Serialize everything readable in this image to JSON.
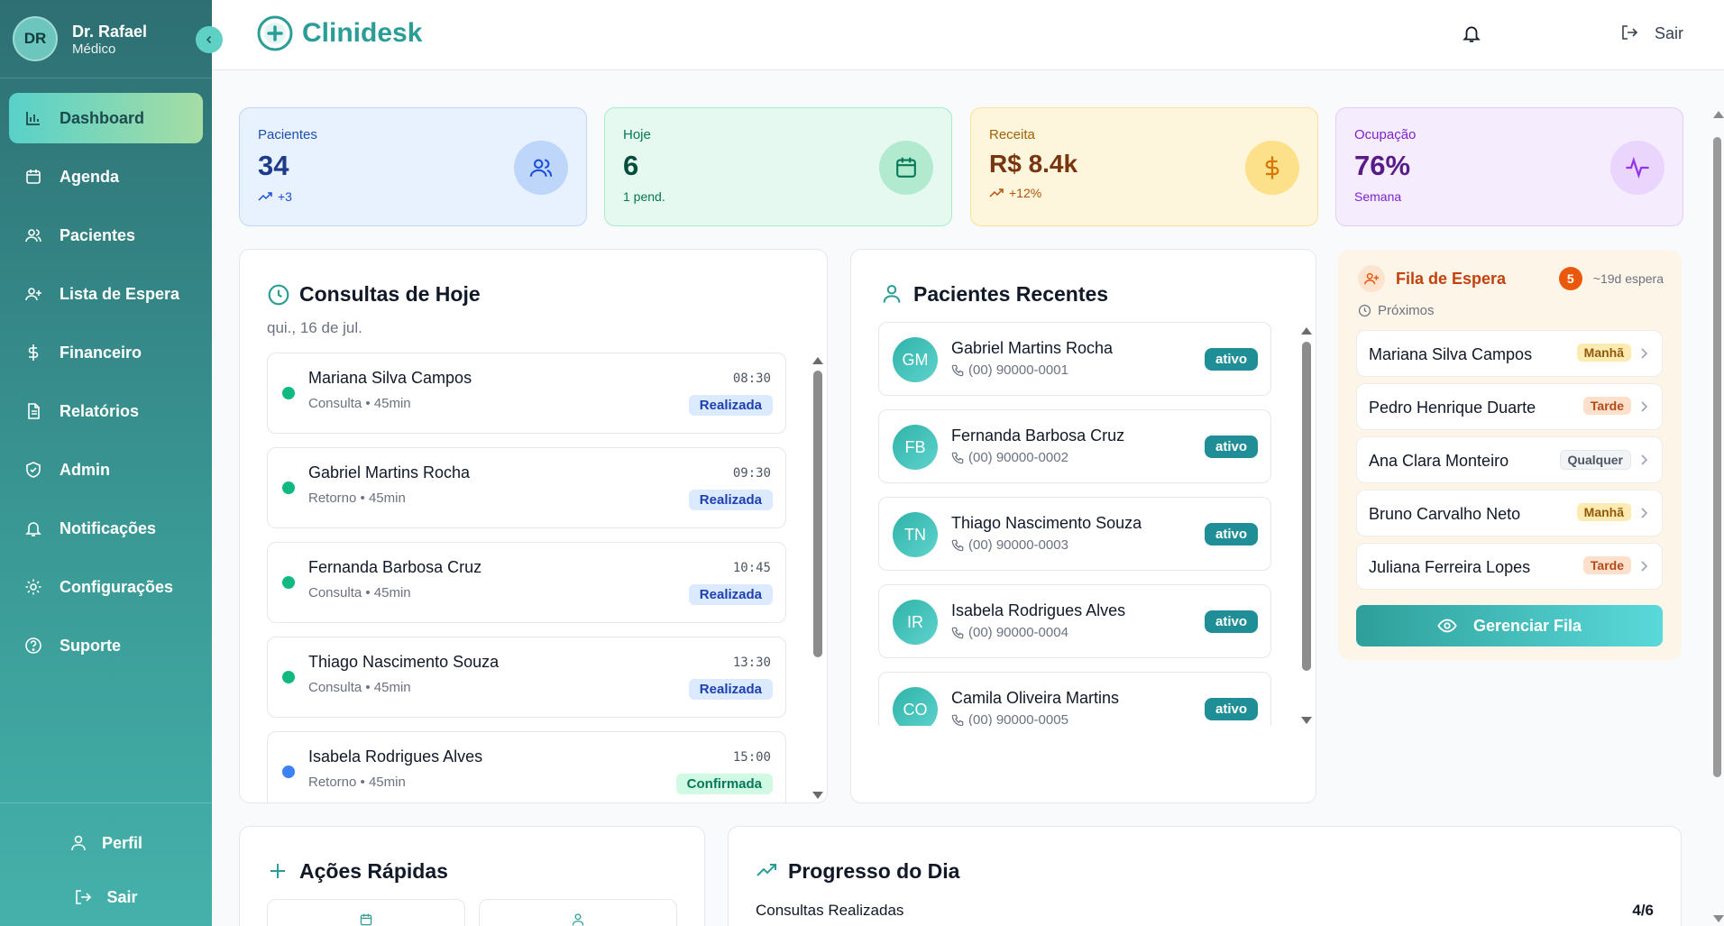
{
  "colors": {
    "accent": "#2a9d96",
    "sidebar": "#2e6f73",
    "queue_accent": "#ea580c"
  },
  "user": {
    "initials": "DR",
    "name": "Dr. Rafael",
    "role": "Médico"
  },
  "nav": [
    {
      "label": "Dashboard",
      "icon": "bar-chart-icon"
    },
    {
      "label": "Agenda",
      "icon": "calendar-icon"
    },
    {
      "label": "Pacientes",
      "icon": "users-icon"
    },
    {
      "label": "Lista de Espera",
      "icon": "user-plus-icon"
    },
    {
      "label": "Financeiro",
      "icon": "dollar-icon"
    },
    {
      "label": "Relatórios",
      "icon": "file-icon"
    },
    {
      "label": "Admin",
      "icon": "shield-icon"
    },
    {
      "label": "Notificações",
      "icon": "bell-icon"
    },
    {
      "label": "Configurações",
      "icon": "gear-icon"
    },
    {
      "label": "Suporte",
      "icon": "help-icon"
    }
  ],
  "footer": {
    "profile": "Perfil",
    "logout": "Sair"
  },
  "topbar": {
    "brand": "Clinidesk",
    "logout": "Sair"
  },
  "stats": [
    {
      "label": "Pacientes",
      "value": "34",
      "sub": "+3"
    },
    {
      "label": "Hoje",
      "value": "6",
      "sub": "1 pend."
    },
    {
      "label": "Receita",
      "value": "R$ 8.4k",
      "sub": "+12%"
    },
    {
      "label": "Ocupação",
      "value": "76%",
      "sub": "Semana"
    }
  ],
  "appointments": {
    "title": "Consultas de Hoje",
    "date": "qui., 16 de jul.",
    "items": [
      {
        "name": "Mariana Silva Campos",
        "meta": "Consulta • 45min",
        "time": "08:30",
        "status": "Realizada"
      },
      {
        "name": "Gabriel Martins Rocha",
        "meta": "Retorno • 45min",
        "time": "09:30",
        "status": "Realizada"
      },
      {
        "name": "Fernanda Barbosa Cruz",
        "meta": "Consulta • 45min",
        "time": "10:45",
        "status": "Realizada"
      },
      {
        "name": "Thiago Nascimento Souza",
        "meta": "Consulta • 45min",
        "time": "13:30",
        "status": "Realizada"
      },
      {
        "name": "Isabela Rodrigues Alves",
        "meta": "Retorno • 45min",
        "time": "15:00",
        "status": "Confirmada"
      }
    ]
  },
  "recent": {
    "title": "Pacientes Recentes",
    "items": [
      {
        "initials": "GM",
        "name": "Gabriel Martins Rocha",
        "phone": "(00) 90000-0001",
        "status": "ativo"
      },
      {
        "initials": "FB",
        "name": "Fernanda Barbosa Cruz",
        "phone": "(00) 90000-0002",
        "status": "ativo"
      },
      {
        "initials": "TN",
        "name": "Thiago Nascimento Souza",
        "phone": "(00) 90000-0003",
        "status": "ativo"
      },
      {
        "initials": "IR",
        "name": "Isabela Rodrigues Alves",
        "phone": "(00) 90000-0004",
        "status": "ativo"
      },
      {
        "initials": "CO",
        "name": "Camila Oliveira Martins",
        "phone": "(00) 90000-0005",
        "status": "ativo"
      }
    ]
  },
  "queue": {
    "title": "Fila de Espera",
    "count": "5",
    "wait": "~19d espera",
    "subtitle": "Próximos",
    "items": [
      {
        "name": "Mariana Silva Campos",
        "period": "Manhã"
      },
      {
        "name": "Pedro Henrique Duarte",
        "period": "Tarde"
      },
      {
        "name": "Ana Clara Monteiro",
        "period": "Qualquer"
      },
      {
        "name": "Bruno Carvalho Neto",
        "period": "Manhã"
      },
      {
        "name": "Juliana Ferreira Lopes",
        "period": "Tarde"
      }
    ],
    "button": "Gerenciar Fila"
  },
  "quick_actions": {
    "title": "Ações Rápidas"
  },
  "progress": {
    "title": "Progresso do Dia",
    "label": "Consultas Realizadas",
    "value": "4/6",
    "fraction": 0.667
  }
}
